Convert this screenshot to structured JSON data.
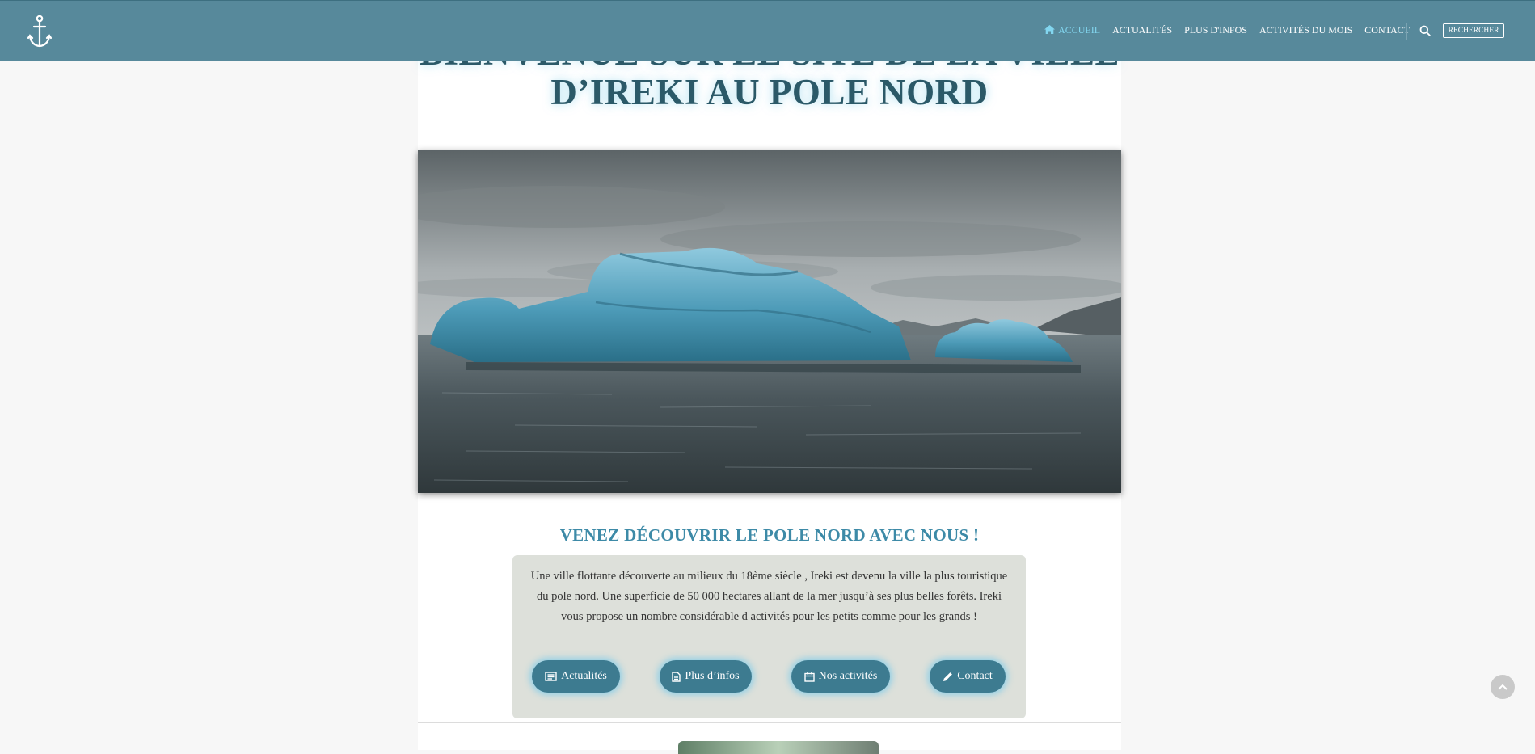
{
  "hero": {
    "title_line1": "BIENVENUE SUR LE SITE DE LA VILLE",
    "title_line2": "D’IREKI AU POLE NORD"
  },
  "nav": {
    "logo_icon": "anchor-icon",
    "items": [
      {
        "label": "ACCUEIL",
        "icon": "home-icon",
        "active": true
      },
      {
        "label": "ACTUALITÉS"
      },
      {
        "label": "PLUS D'INFOS"
      },
      {
        "label": "ACTIVITÉS DU MOIS"
      },
      {
        "label": "CONTACT"
      }
    ],
    "search_icon": "search-icon",
    "search_button": "RECHERCHER"
  },
  "section": {
    "title": "VENEZ DÉCOUVRIR LE POLE NORD AVEC NOUS !",
    "text": "Une ville flottante découverte au milieux du 18ème siècle , Ireki est devenu la ville la plus touristique du pole nord. Une superficie de 50 000 hectares allant de la mer jusqu’à ses plus belles forêts. Ireki vous propose un nombre considérable d activités pour les petits comme pour les grands !",
    "buttons": [
      {
        "label": "Actualités",
        "icon": "newspaper-icon"
      },
      {
        "label": "Plus d’infos",
        "icon": "file-icon"
      },
      {
        "label": "Nos activités",
        "icon": "calendar-icon"
      },
      {
        "label": "Contact",
        "icon": "pencil-icon"
      }
    ]
  },
  "colors": {
    "navbar": "#57899b",
    "active_nav": "#82d6ef",
    "title": "#2b5968",
    "section_title": "#3d8aa7",
    "button": "#3d7b90",
    "info_box": "#dde0da"
  },
  "scroll_top_icon": "chevron-up-icon"
}
